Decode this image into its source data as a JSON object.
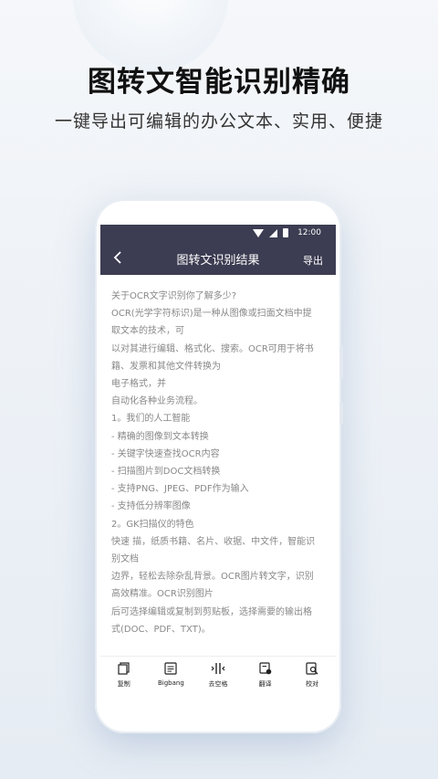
{
  "header": {
    "headline": "图转文智能识别精确",
    "subline": "一键导出可编辑的办公文本、实用、便捷"
  },
  "status_bar": {
    "time": "12:00"
  },
  "app_bar": {
    "back_icon": "chevron-left-icon",
    "title": "图转文识别结果",
    "export_label": "导出"
  },
  "content_lines": [
    "关于OCR文字识别你了解多少?",
    "OCR(光学字符标识)是一种从图像或扫面文档中提",
    "取文本的技术，可",
    "以对其进行编辑、格式化、搜索。OCR可用于将书",
    "籍、发票和其他文件转换为",
    "电子格式，并",
    "自动化各种业务流程。",
    "1。我们的人工智能",
    "- 精确的图像到文本转换",
    "- 关键字快速查找OCR内容",
    "- 扫描图片到DOC文档转换",
    "- 支持PNG、JPEG、PDF作为输入",
    "- 支持低分辨率图像",
    "2。GK扫描仪的特色",
    "快速 描，纸质书籍、名片、收据、中文件，智能识",
    "别文档",
    "边界，轻松去除杂乱背景。OCR图片转文字，识别",
    "高效精准。OCR识别图片",
    "后可选择编辑或复制到剪贴板，选择需要的输出格",
    "式(DOC、PDF、TXT)。"
  ],
  "toolbar": {
    "items": [
      {
        "label": "复制",
        "icon": "copy-icon"
      },
      {
        "label": "Bigbang",
        "icon": "bigbang-icon"
      },
      {
        "label": "去空格",
        "icon": "remove-space-icon"
      },
      {
        "label": "翻译",
        "icon": "translate-icon"
      },
      {
        "label": "校对",
        "icon": "proofread-icon"
      }
    ]
  }
}
